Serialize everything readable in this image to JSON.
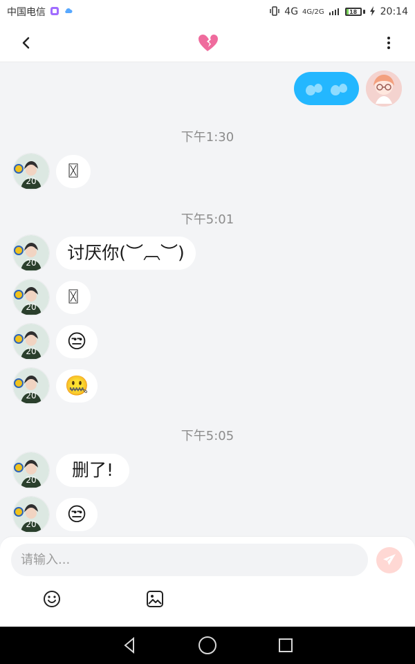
{
  "status_bar": {
    "carrier": "中国电信",
    "network_primary": "4G",
    "network_secondary": "4G/2G",
    "battery": "18",
    "time": "20:14"
  },
  "header": {
    "back_icon": "chevron-left-icon",
    "center_icon": "broken-heart-icon",
    "menu_icon": "more-vertical-icon"
  },
  "chat": {
    "sent_message": {
      "emoji": "💦💦"
    },
    "messages": [
      {
        "time": "下午1:30"
      },
      {
        "text": "〿"
      },
      {
        "time": "下午5:01"
      },
      {
        "text": "讨厌你(︶︹︶)"
      },
      {
        "text": "〿"
      },
      {
        "text": "😒"
      },
      {
        "text": "🤐"
      },
      {
        "time": "下午5:05"
      },
      {
        "text": "删了!"
      },
      {
        "text": "😒"
      }
    ]
  },
  "composer": {
    "placeholder": "请输入...",
    "send_icon": "send-icon",
    "emoji_icon": "emoji-icon",
    "image_icon": "image-icon"
  },
  "navigation": {
    "back_button": "triangle-back-icon",
    "home_button": "home-circle-icon",
    "recent_button": "square-recent-icon"
  }
}
